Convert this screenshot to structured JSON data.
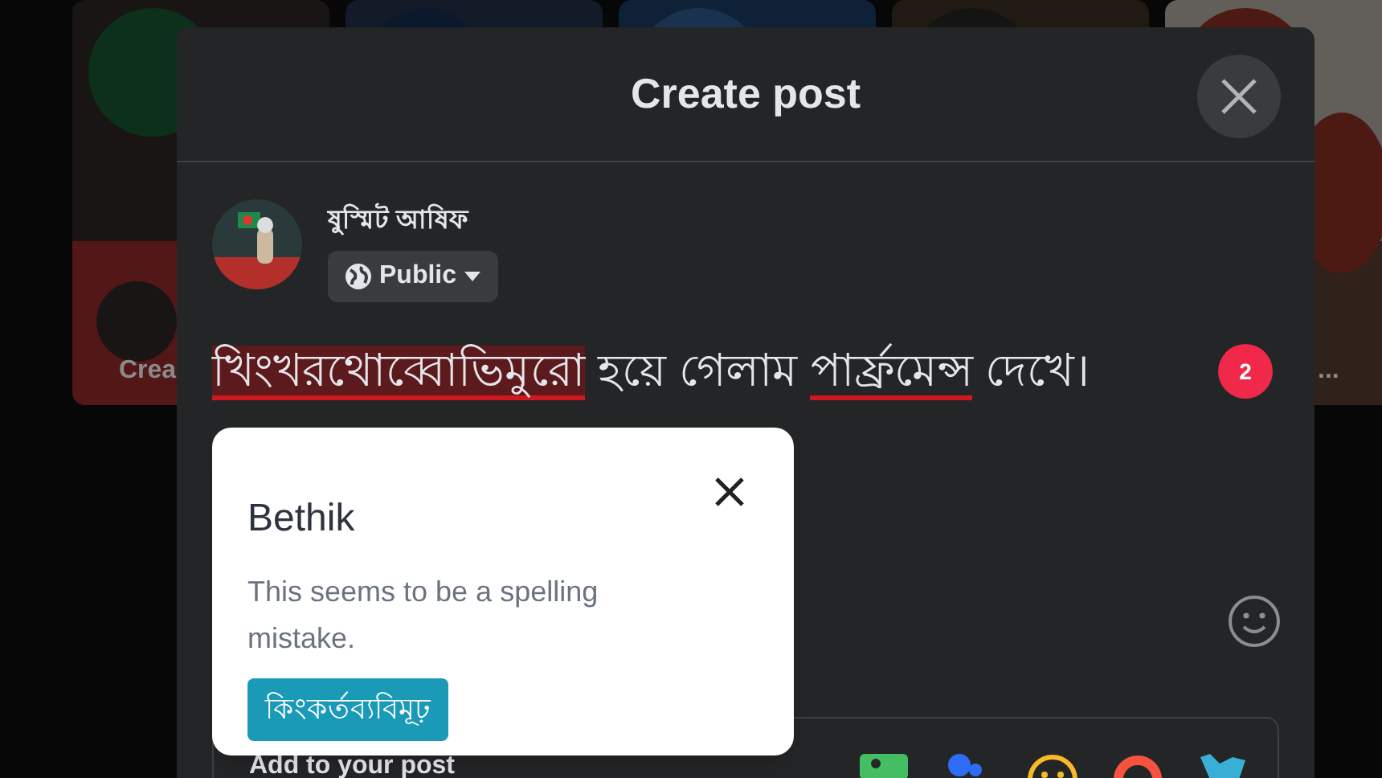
{
  "background": {
    "stories": [
      {
        "label": "Crea"
      },
      {
        "label": "..."
      }
    ]
  },
  "dialog": {
    "title": "Create post",
    "author": {
      "name": "ষুস্মিট আষিফ",
      "audience": "Public"
    },
    "post_text": [
      {
        "text": "খিংখরথোব্বোভিমুরো",
        "error": true,
        "highlighted": true
      },
      {
        "text": " হয়ে গেলাম ",
        "error": false,
        "highlighted": false
      },
      {
        "text": "পার্ফ্রমেন্স",
        "error": true,
        "highlighted": false
      },
      {
        "text": " দেখে।",
        "error": false,
        "highlighted": false
      }
    ],
    "error_count": "2",
    "add_to_post": {
      "label": "Add to your post"
    }
  },
  "suggestion_popup": {
    "title": "Bethik",
    "message": "This seems to be a spelling mistake.",
    "suggestions": [
      "কিংকর্তব্যবিমূঢ়"
    ]
  }
}
